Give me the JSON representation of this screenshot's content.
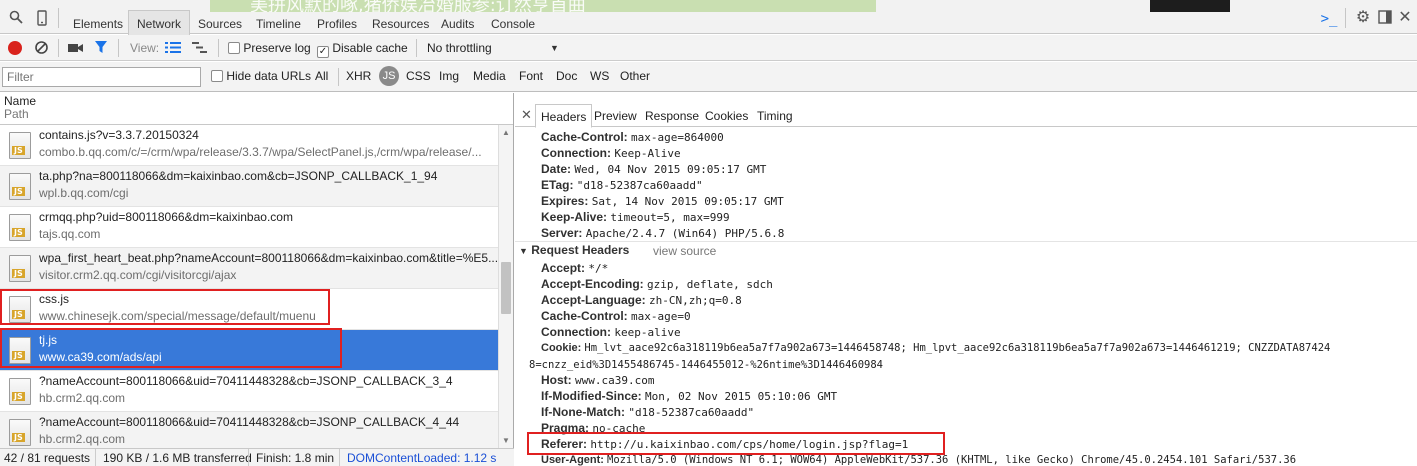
{
  "banner_text": "美拼风默的啄,猪侨娱冶婚服参:订然亨首曲",
  "top_tabs": [
    {
      "label": "Elements"
    },
    {
      "label": "Network"
    },
    {
      "label": "Sources"
    },
    {
      "label": "Timeline"
    },
    {
      "label": "Profiles"
    },
    {
      "label": "Resources"
    },
    {
      "label": "Audits"
    },
    {
      "label": "Console"
    }
  ],
  "toolbar": {
    "view_label": "View:",
    "preserve_log": "Preserve log",
    "disable_cache": "Disable cache",
    "throttle": "No throttling"
  },
  "filter": {
    "placeholder": "Filter",
    "hide_data_urls": "Hide data URLs",
    "types": [
      "All",
      "XHR",
      "JS",
      "CSS",
      "Img",
      "Media",
      "Font",
      "Doc",
      "WS",
      "Other"
    ]
  },
  "columns": {
    "name": "Name",
    "path": "Path"
  },
  "file_icon_label": "JS",
  "requests": [
    {
      "name": "contains.js?v=3.3.7.20150324",
      "path": "combo.b.qq.com/c/=/crm/wpa/release/3.3.7/wpa/SelectPanel.js,/crm/wpa/release/..."
    },
    {
      "name": "ta.php?na=800118066&dm=kaixinbao.com&cb=JSONP_CALLBACK_1_94",
      "path": "wpl.b.qq.com/cgi"
    },
    {
      "name": "crmqq.php?uid=800118066&dm=kaixinbao.com",
      "path": "tajs.qq.com"
    },
    {
      "name": "wpa_first_heart_beat.php?nameAccount=800118066&dm=kaixinbao.com&title=%E5...",
      "path": "visitor.crm2.qq.com/cgi/visitorcgi/ajax"
    },
    {
      "name": "css.js",
      "path": "www.chinesejk.com/special/message/default/muenu"
    },
    {
      "name": "tj.js",
      "path": "www.ca39.com/ads/api"
    },
    {
      "name": "?nameAccount=800118066&uid=70411448328&cb=JSONP_CALLBACK_3_4",
      "path": "hb.crm2.qq.com"
    },
    {
      "name": "?nameAccount=800118066&uid=70411448328&cb=JSONP_CALLBACK_4_44",
      "path": "hb.crm2.qq.com"
    }
  ],
  "status": {
    "requests": "42 / 81 requests",
    "transferred": "190 KB / 1.6 MB transferred",
    "finish": "Finish: 1.8 min",
    "dcl": "DOMContentLoaded: 1.12 s"
  },
  "detail_tabs": [
    "Headers",
    "Preview",
    "Response",
    "Cookies",
    "Timing"
  ],
  "response_headers": [
    {
      "k": "Cache-Control:",
      "v": "max-age=864000"
    },
    {
      "k": "Connection:",
      "v": "Keep-Alive"
    },
    {
      "k": "Date:",
      "v": "Wed, 04 Nov 2015 09:05:17 GMT"
    },
    {
      "k": "ETag:",
      "v": "\"d18-52387ca60aadd\""
    },
    {
      "k": "Expires:",
      "v": "Sat, 14 Nov 2015 09:05:17 GMT"
    },
    {
      "k": "Keep-Alive:",
      "v": "timeout=5, max=999"
    },
    {
      "k": "Server:",
      "v": "Apache/2.4.7 (Win64) PHP/5.6.8"
    }
  ],
  "request_section": {
    "title": "Request Headers",
    "view_source": "view source"
  },
  "request_headers": [
    {
      "k": "Accept:",
      "v": "*/*"
    },
    {
      "k": "Accept-Encoding:",
      "v": "gzip, deflate, sdch"
    },
    {
      "k": "Accept-Language:",
      "v": "zh-CN,zh;q=0.8"
    },
    {
      "k": "Cache-Control:",
      "v": "max-age=0"
    },
    {
      "k": "Connection:",
      "v": "keep-alive"
    },
    {
      "k": "Cookie:",
      "v": "Hm_lvt_aace92c6a318119b6ea5a7f7a902a673=1446458748; Hm_lpvt_aace92c6a318119b6ea5a7f7a902a673=1446461219; CNZZDATA87424"
    },
    {
      "k": "",
      "v": "8=cnzz_eid%3D1455486745-1446455012-%26ntime%3D1446460984"
    },
    {
      "k": "Host:",
      "v": "www.ca39.com"
    },
    {
      "k": "If-Modified-Since:",
      "v": "Mon, 02 Nov 2015 05:10:06 GMT"
    },
    {
      "k": "If-None-Match:",
      "v": "\"d18-52387ca60aadd\""
    },
    {
      "k": "Pragma:",
      "v": "no-cache"
    },
    {
      "k": "Referer:",
      "v": "http://u.kaixinbao.com/cps/home/login.jsp?flag=1"
    },
    {
      "k": "User-Agent:",
      "v": "Mozilla/5.0 (Windows NT 6.1; WOW64) AppleWebKit/537.36 (KHTML, like Gecko) Chrome/45.0.2454.101 Safari/537.36"
    }
  ]
}
